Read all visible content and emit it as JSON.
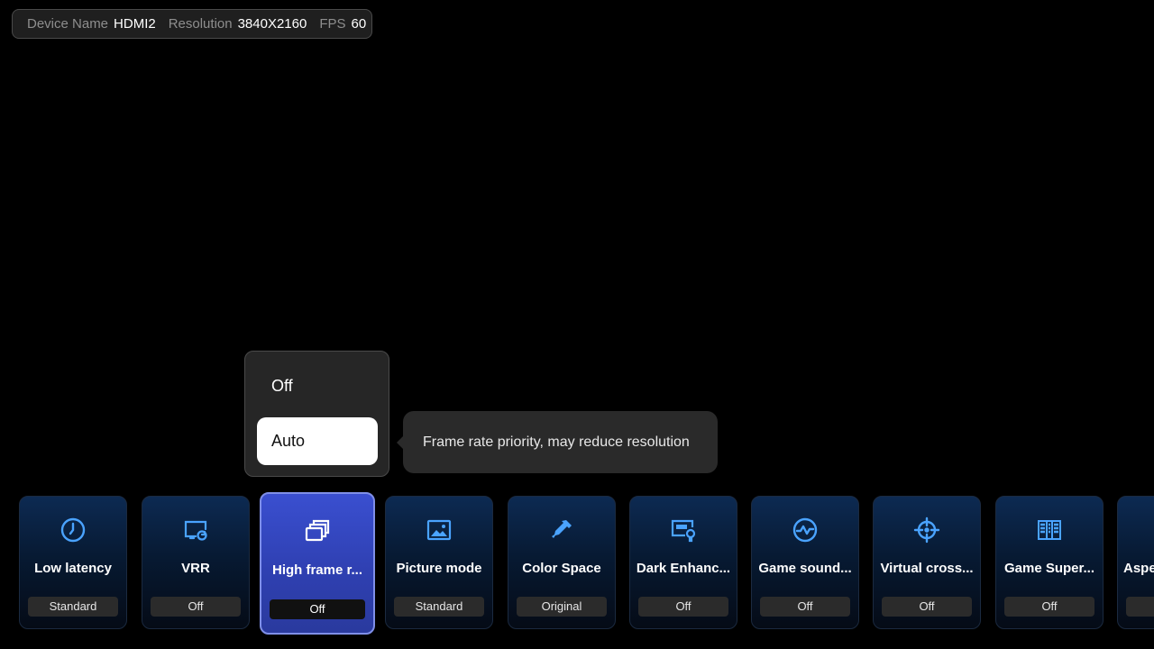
{
  "info_bar": {
    "device_label": "Device Name",
    "device_value": "HDMI2",
    "resolution_label": "Resolution",
    "resolution_value": "3840X2160",
    "fps_label": "FPS",
    "fps_value": "60"
  },
  "dropdown": {
    "options": [
      "Off",
      "Auto"
    ],
    "highlighted": "Auto"
  },
  "tooltip": {
    "text": "Frame rate priority, may reduce resolution"
  },
  "accent_color": "#4aa3ff",
  "tiles": [
    {
      "name": "Low latency",
      "value": "Standard",
      "icon": "clock-icon"
    },
    {
      "name": "VRR",
      "value": "Off",
      "icon": "screen-refresh-icon"
    },
    {
      "name": "High frame r...",
      "value": "Off",
      "icon": "stacked-windows-icon",
      "active": true
    },
    {
      "name": "Picture mode",
      "value": "Standard",
      "icon": "picture-icon"
    },
    {
      "name": "Color Space",
      "value": "Original",
      "icon": "eyedropper-icon"
    },
    {
      "name": "Dark Enhanc...",
      "value": "Off",
      "icon": "monitor-bulb-icon"
    },
    {
      "name": "Game sound...",
      "value": "Off",
      "icon": "waveform-circle-icon"
    },
    {
      "name": "Virtual cross...",
      "value": "Off",
      "icon": "crosshair-icon"
    },
    {
      "name": "Game Super...",
      "value": "Off",
      "icon": "panel-grid-icon"
    },
    {
      "name": "Aspe",
      "value": "",
      "icon": "aspect-icon"
    }
  ]
}
